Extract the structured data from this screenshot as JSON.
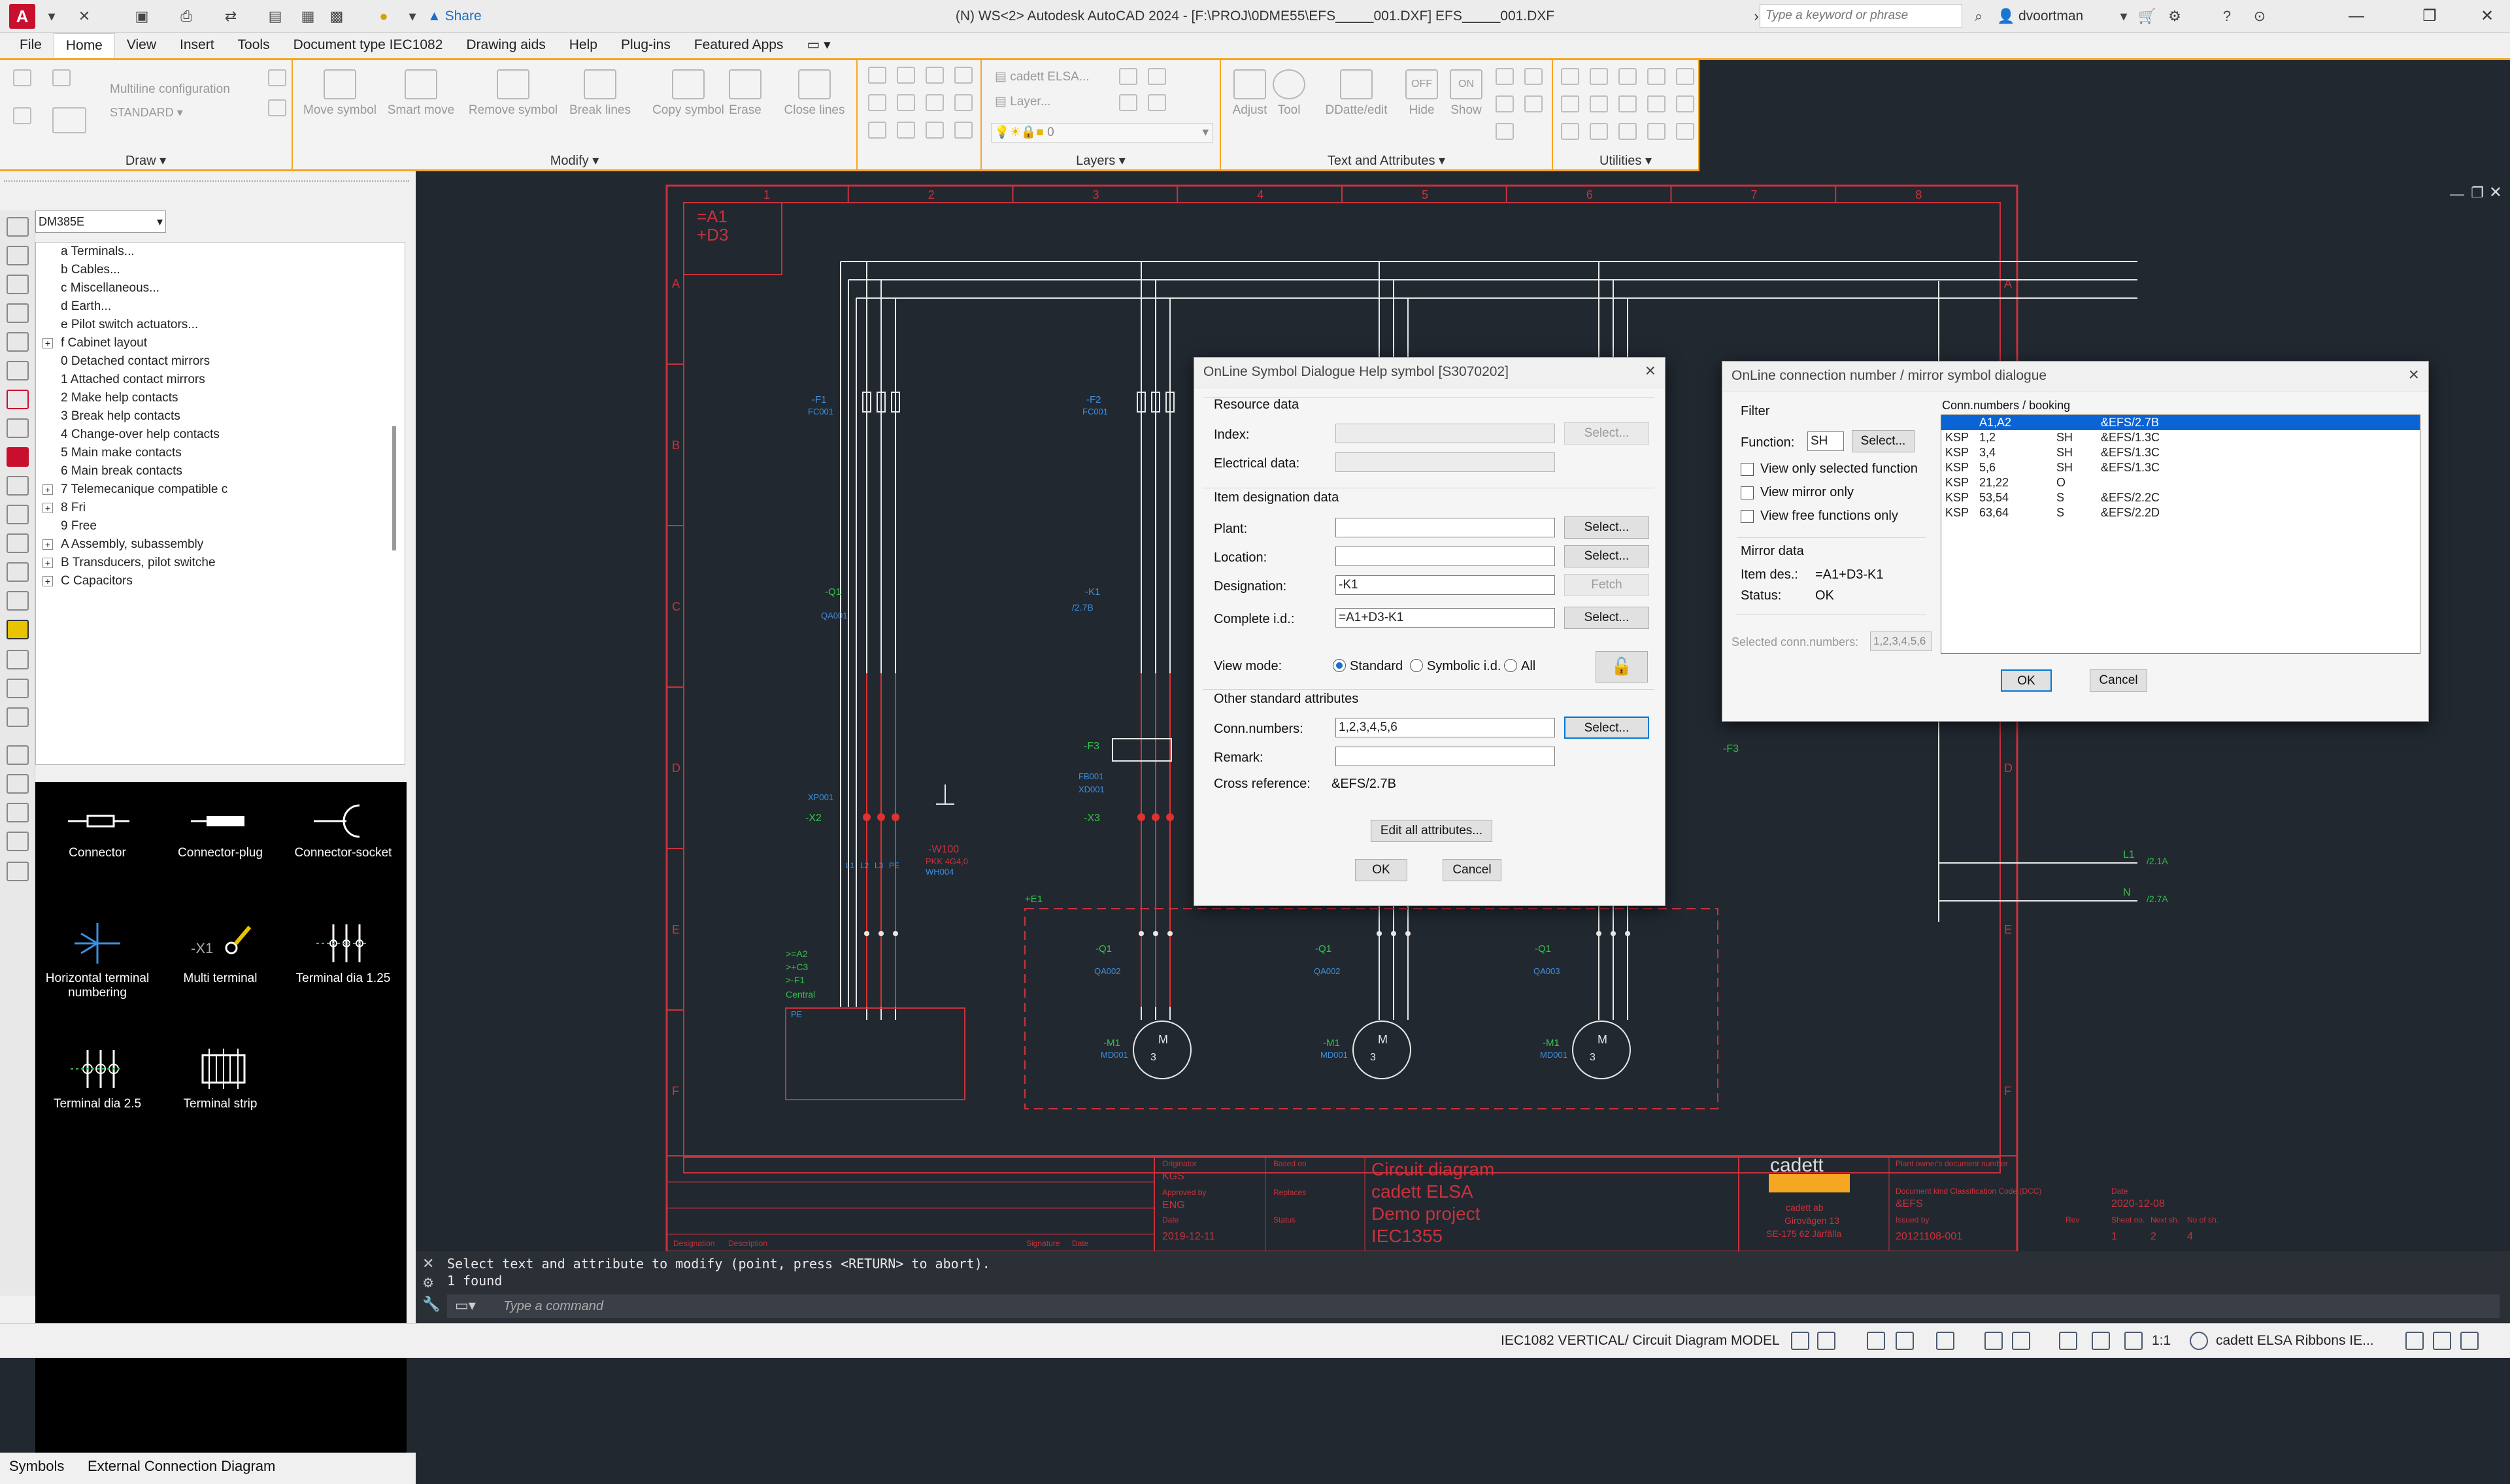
{
  "titlebar": {
    "app_letter": "A",
    "share_label": "Share",
    "window_title": "(N) WS<2> Autodesk AutoCAD 2024 - [F:\\PROJ\\0DME55\\EFS_____001.DXF]   EFS_____001.DXF",
    "search_placeholder": "Type a keyword or phrase",
    "user": "dvoortman"
  },
  "menu": [
    "File",
    "Home",
    "View",
    "Insert",
    "Tools",
    "Document type IEC1082",
    "Drawing aids",
    "Help",
    "Plug-ins",
    "Featured Apps"
  ],
  "menu_active": "Home",
  "ribbon": {
    "draw": {
      "title": "Draw",
      "multiline": "Multiline configuration",
      "standard": "STANDARD"
    },
    "modify": {
      "title": "Modify",
      "tools": [
        "Move symbol",
        "Smart move",
        "Remove symbol",
        "Break lines",
        "Copy symbol",
        "Erase",
        "Close lines"
      ]
    },
    "layers": {
      "title": "Layers",
      "cadett": "cadett ELSA...",
      "layer": "Layer...",
      "zero": "0"
    },
    "text_attr": {
      "title": "Text and Attributes",
      "tools": [
        "Adjust",
        "Tool",
        "DDatte/edit",
        "Hide",
        "Show"
      ],
      "off": "OFF",
      "on": "ON"
    },
    "utilities": {
      "title": "Utilities"
    }
  },
  "left_panel": {
    "combo_value": "DM385E",
    "tree": [
      {
        "label": "a Terminals...",
        "expandable": false
      },
      {
        "label": "b Cables...",
        "expandable": false
      },
      {
        "label": "c Miscellaneous...",
        "expandable": false
      },
      {
        "label": "d Earth...",
        "expandable": false
      },
      {
        "label": "e Pilot switch actuators...",
        "expandable": false
      },
      {
        "label": "f Cabinet layout",
        "expandable": true
      },
      {
        "label": "0 Detached contact mirrors",
        "expandable": false
      },
      {
        "label": "1 Attached contact mirrors",
        "expandable": false
      },
      {
        "label": "2 Make help contacts",
        "expandable": false
      },
      {
        "label": "3 Break help contacts",
        "expandable": false
      },
      {
        "label": "4 Change-over help contacts",
        "expandable": false
      },
      {
        "label": "5 Main make contacts",
        "expandable": false
      },
      {
        "label": "6 Main break contacts",
        "expandable": false
      },
      {
        "label": "7 Telemecanique compatible c",
        "expandable": true
      },
      {
        "label": "8 Fri",
        "expandable": true
      },
      {
        "label": "9 Free",
        "expandable": false
      },
      {
        "label": "A Assembly, subassembly",
        "expandable": true
      },
      {
        "label": "B Transducers, pilot switche",
        "expandable": true
      },
      {
        "label": "C Capacitors",
        "expandable": true
      }
    ],
    "symbols": [
      "Connector",
      "Connector-plug",
      "Connector-socket",
      "Horizontal terminal numbering",
      "Multi terminal",
      "Terminal dia 1.25",
      "Terminal dia 2.5",
      "Terminal strip"
    ],
    "sym_text": {
      "x1": "-X1"
    },
    "tabs": [
      "Symbols",
      "External Connection Diagram"
    ]
  },
  "drawing": {
    "column_numbers": [
      "1",
      "2",
      "3",
      "4",
      "5",
      "6",
      "7",
      "8"
    ],
    "row_letters": [
      "A",
      "B",
      "C",
      "D",
      "E",
      "F"
    ],
    "id_block": [
      "=A1",
      "+D3"
    ],
    "labels": {
      "f1": "-F1",
      "fc001": "FC001",
      "f2": "-F2",
      "fc002": "FC001",
      "q1": "-Q1",
      "qa001": "QA001",
      "k1": "-K1",
      "k1ref": "/2.7B",
      "f3": "-F3",
      "fb001": "FB001",
      "f3b": "-F3",
      "x2": "-X2",
      "x3": "-X3",
      "xp001": "XP001",
      "x3b": "XD001",
      "w100": "-W100",
      "w100b": "PKK 4G4,0",
      "w100c": "WH004",
      "e1": "+E1",
      "a2": ">=A2",
      "c3": ">+C3",
      "f1c": ">-F1",
      "central": "Central",
      "pos": "PE",
      "f1d": "-F1",
      "q1b": "-Q1",
      "qa002": "QA002",
      "q1c": "-Q1",
      "qa003": "QA002",
      "q1d": "-Q1",
      "qa004": "QA003",
      "m1": "-M1",
      "md001": "MD001",
      "m1b": "-M1",
      "md002": "MD001",
      "m1c": "-M1",
      "md003": "MD001",
      "motor_m": "M",
      "motor_3": "3",
      "l1": "L1",
      "l1ref": "/2.1A",
      "n": "N",
      "nref": "/2.7A",
      "terminal_names": [
        "L1",
        "L2",
        "L3",
        "PE"
      ]
    },
    "title_block": {
      "originator_label": "Originator",
      "originator": "KGS",
      "based_on_label": "Based on",
      "approved_label": "Approved by",
      "approved": "ENG",
      "replaces_label": "Replaces",
      "date_label": "Date",
      "date": "2019-12-11",
      "status_label": "Status",
      "designation_label": "Designation",
      "description_label": "Description",
      "signature_label": "Signature",
      "date2_label": "Date",
      "title_lines": [
        "Circuit diagram",
        "cadett ELSA",
        "Demo project",
        "IEC1355"
      ],
      "company_logo": "cadett",
      "company": "cadett ab",
      "address": [
        "Girovägen 13",
        "SE-175 62 Järfälla"
      ],
      "owner_doc_label": "Plant owner's document number",
      "doc_kind_label": "Document kind Classification Code (DCC)",
      "doc_kind": "&EFS",
      "date3_label": "Date",
      "date3": "2020-12-08",
      "issued_label": "Issued by",
      "doc_number": "20121108-001",
      "rev_label": "Rev",
      "sheet_label": "Sheet no.",
      "next_label": "Next sh.",
      "noof_label": "No of sh.",
      "sheet": "1",
      "next": "2",
      "noof": "4"
    }
  },
  "symbol_dialog": {
    "title": "OnLine Symbol Dialogue Help symbol [S3070202]",
    "resource_data": "Resource data",
    "index_label": "Index:",
    "index_value": "",
    "electrical_label": "Electrical data:",
    "electrical_value": "",
    "item_designation": "Item designation data",
    "plant_label": "Plant:",
    "plant_value": "",
    "location_label": "Location:",
    "location_value": "",
    "designation_label": "Designation:",
    "designation_value": "-K1",
    "complete_label": "Complete i.d.:",
    "complete_value": "=A1+D3-K1",
    "view_mode_label": "View mode:",
    "view_modes": [
      "Standard",
      "Symbolic i.d.",
      "All"
    ],
    "view_mode_selected": "Standard",
    "other_attr": "Other standard attributes",
    "conn_label": "Conn.numbers:",
    "conn_value": "1,2,3,4,5,6",
    "remark_label": "Remark:",
    "remark_value": "",
    "crossref_label": "Cross reference:",
    "crossref_value": "&EFS/2.7B",
    "select": "Select...",
    "fetch": "Fetch",
    "edit_all": "Edit all attributes...",
    "ok": "OK",
    "cancel": "Cancel"
  },
  "conn_dialog": {
    "title": "OnLine connection number / mirror symbol dialogue",
    "filter": "Filter",
    "function_label": "Function:",
    "function_value": "SH",
    "select": "Select...",
    "checks": [
      "View only selected function",
      "View mirror only",
      "View free functions only"
    ],
    "mirror_data": "Mirror data",
    "item_des_label": "Item des.:",
    "item_des_value": "=A1+D3-K1",
    "status_label": "Status:",
    "status_value": "OK",
    "selected_conn_label": "Selected conn.numbers:",
    "selected_conn_value": "1,2,3,4,5,6",
    "list_header": "Conn.numbers / booking",
    "rows": [
      {
        "type": "",
        "nums": "A1,A2",
        "func": "",
        "ref": "&EFS/2.7B",
        "selected": true
      },
      {
        "type": "KSP",
        "nums": "1,2",
        "func": "SH",
        "ref": "&EFS/1.3C",
        "selected": false
      },
      {
        "type": "KSP",
        "nums": "3,4",
        "func": "SH",
        "ref": "&EFS/1.3C",
        "selected": false
      },
      {
        "type": "KSP",
        "nums": "5,6",
        "func": "SH",
        "ref": "&EFS/1.3C",
        "selected": false
      },
      {
        "type": "KSP",
        "nums": "21,22",
        "func": "O",
        "ref": "",
        "selected": false
      },
      {
        "type": "KSP",
        "nums": "53,54",
        "func": "S",
        "ref": "&EFS/2.2C",
        "selected": false
      },
      {
        "type": "KSP",
        "nums": "63,64",
        "func": "S",
        "ref": "&EFS/2.2D",
        "selected": false
      }
    ],
    "ok": "OK",
    "cancel": "Cancel"
  },
  "command": {
    "history": [
      "Select text and attribute to modify (point, press <RETURN> to abort).",
      "1 found"
    ],
    "placeholder": "Type a command"
  },
  "statusbar": {
    "layout": "IEC1082 VERTICAL/ Circuit Diagram",
    "model": "MODEL",
    "scale": "1:1",
    "workspace": "cadett ELSA Ribbons IE..."
  },
  "colors": {
    "accent": "#f5a623",
    "cad_bg": "#212830",
    "frame_red": "#c8323c",
    "wire": "#e8e8e8",
    "label_blue": "#3d8fe0",
    "label_green": "#34c24a",
    "selection_blue": "#0a64d6"
  }
}
